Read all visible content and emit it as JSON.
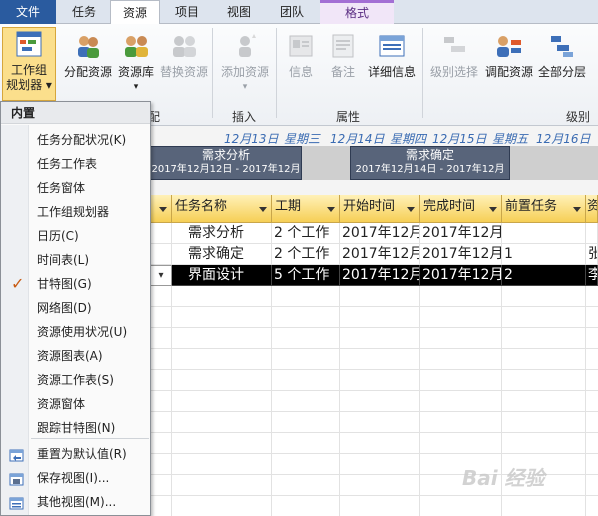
{
  "tabs": {
    "file": "文件",
    "task": "任务",
    "resource": "资源",
    "project": "项目",
    "view": "视图",
    "team": "团队",
    "format": "格式"
  },
  "ribbon": {
    "team_planner": "工作组\n规划器",
    "team_planner_l1": "工作组",
    "team_planner_l2": "规划器",
    "assign_resources": "分配资源",
    "resource_pool": "资源库",
    "replace_resource": "替换资源",
    "add_resource": "添加资源",
    "info": "信息",
    "notes": "备注",
    "details": "详细信息",
    "level_selection": "级别选择",
    "level_resource": "调配资源",
    "level_all": "全部分层",
    "group_assign": "配",
    "group_insert": "插入",
    "group_properties": "属性",
    "group_level": "级别"
  },
  "timeline": {
    "headers": [
      "12月13日",
      "星期三",
      "12月14日",
      "星期四",
      "12月15日",
      "星期五",
      "12月16日"
    ],
    "bars": [
      {
        "name": "需求分析",
        "dates": "2017年12月12日 - 2017年12月"
      },
      {
        "name": "需求确定",
        "dates": "2017年12月14日 - 2017年12月"
      }
    ]
  },
  "grid": {
    "columns": [
      "任务名称",
      "工期",
      "开始时间",
      "完成时间",
      "前置任务",
      "资"
    ],
    "rows": [
      {
        "name": "需求分析",
        "duration": "2 个工作",
        "start": "2017年12月",
        "finish": "2017年12月",
        "pred": "",
        "res": ""
      },
      {
        "name": "需求确定",
        "duration": "2 个工作",
        "start": "2017年12月",
        "finish": "2017年12月",
        "pred": "1",
        "res": "张"
      },
      {
        "name": "界面设计",
        "duration": "5 个工作",
        "start": "2017年12月",
        "finish": "2017年12月",
        "pred": "2",
        "res": "李"
      }
    ]
  },
  "menu": {
    "header": "内置",
    "items": [
      "任务分配状况(K)",
      "任务工作表",
      "任务窗体",
      "工作组规划器",
      "日历(C)",
      "时间表(L)",
      "甘特图(G)",
      "网络图(D)",
      "资源使用状况(U)",
      "资源图表(A)",
      "资源工作表(S)",
      "资源窗体",
      "跟踪甘特图(N)"
    ],
    "checked_index": 6,
    "commands": [
      "重置为默认值(R)",
      "保存视图(I)...",
      "其他视图(M)..."
    ]
  },
  "watermark": "Bai 经验",
  "colors": {
    "file_tab": "#2a5b9f",
    "accent_header": "#f6cf56",
    "timeline_bar": "#58647a",
    "selected_row": "#000000"
  }
}
